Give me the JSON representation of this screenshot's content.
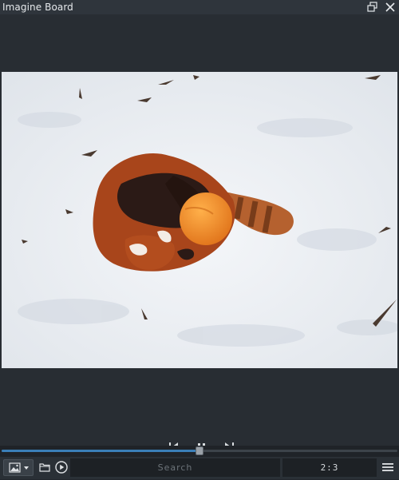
{
  "window": {
    "title": "Imagine Board",
    "restore_icon": "restore-window-icon",
    "close_icon": "close-icon"
  },
  "media": {
    "content": "red panda rolling with an orange ball in the snow",
    "colors": {
      "snow": "#eceff3",
      "fur": "#a24a20",
      "ball": "#f08a1e"
    }
  },
  "controls": {
    "prev_icon": "previous-frame-icon",
    "pause_icon": "pause-icon",
    "next_icon": "next-frame-icon"
  },
  "seek": {
    "position": 0.5,
    "accent": "#3a7fb8"
  },
  "bottombar": {
    "image_menu_icon": "image-icon",
    "folder_icon": "folder-icon",
    "slideshow_icon": "play-circle-icon",
    "search_placeholder": "Search",
    "counter": "2:3",
    "menu_icon": "hamburger-menu-icon"
  }
}
